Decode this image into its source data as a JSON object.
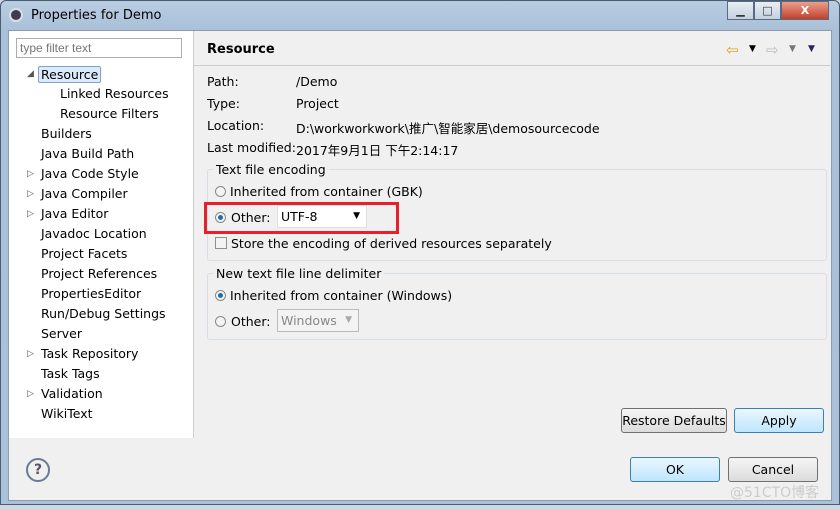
{
  "window": {
    "title": "Properties for Demo",
    "minimize": "▁",
    "maximize": "□",
    "close": "X"
  },
  "filter": {
    "placeholder": "type filter text"
  },
  "tree": [
    {
      "label": "Resource",
      "expanded": true,
      "selected": true,
      "level": 0
    },
    {
      "label": "Linked Resources",
      "level": 1
    },
    {
      "label": "Resource Filters",
      "level": 1
    },
    {
      "label": "Builders",
      "level": 0
    },
    {
      "label": "Java Build Path",
      "level": 0
    },
    {
      "label": "Java Code Style",
      "level": 0,
      "collapsed": true
    },
    {
      "label": "Java Compiler",
      "level": 0,
      "collapsed": true
    },
    {
      "label": "Java Editor",
      "level": 0,
      "collapsed": true
    },
    {
      "label": "Javadoc Location",
      "level": 0
    },
    {
      "label": "Project Facets",
      "level": 0
    },
    {
      "label": "Project References",
      "level": 0
    },
    {
      "label": "PropertiesEditor",
      "level": 0
    },
    {
      "label": "Run/Debug Settings",
      "level": 0
    },
    {
      "label": "Server",
      "level": 0
    },
    {
      "label": "Task Repository",
      "level": 0,
      "collapsed": true
    },
    {
      "label": "Task Tags",
      "level": 0
    },
    {
      "label": "Validation",
      "level": 0,
      "collapsed": true
    },
    {
      "label": "WikiText",
      "level": 0
    }
  ],
  "page": {
    "title": "Resource",
    "info": [
      {
        "label": "Path:",
        "value": "/Demo"
      },
      {
        "label": "Type:",
        "value": "Project"
      },
      {
        "label": "Location:",
        "value": "D:\\workworkwork\\推广\\智能家居\\demosourcecode"
      },
      {
        "label": "Last modified:",
        "value": "2017年9月1日 下午2:14:17"
      }
    ],
    "encoding": {
      "legend": "Text file encoding",
      "inherited": "Inherited from container (GBK)",
      "other": "Other:",
      "other_value": "UTF-8",
      "selected": "other",
      "store_derived": "Store the encoding of derived resources separately",
      "store_checked": false
    },
    "delimiter": {
      "legend": "New text file line delimiter",
      "inherited": "Inherited from container (Windows)",
      "other": "Other:",
      "other_value": "Windows",
      "selected": "inherited"
    },
    "restore_defaults": "Restore Defaults",
    "apply": "Apply"
  },
  "footer": {
    "ok": "OK",
    "cancel": "Cancel",
    "help_icon": "?"
  },
  "watermark": "@51CTO博客",
  "colors": {
    "highlight": "#e8202a",
    "accent": "#1a6fb5"
  }
}
